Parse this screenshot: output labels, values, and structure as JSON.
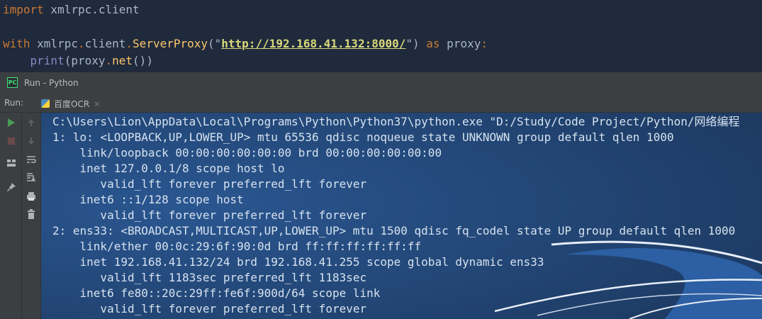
{
  "editor": {
    "line1": {
      "kw": "import",
      "module": " xmlrpc.client"
    },
    "line2": {
      "kw_with": "with",
      "mod": " xmlrpc",
      "dot1": ".",
      "client": "client",
      "dot2": ".",
      "fn": "ServerProxy",
      "open": "(\"",
      "url": "http://192.168.41.132:8000/",
      "close": "\")",
      "kw_as": " as",
      "var": " proxy",
      "colon": ":"
    },
    "line3": {
      "indent": "    ",
      "print": "print",
      "open": "(proxy",
      "dot": ".",
      "method": "net",
      "close": "())"
    }
  },
  "run_window": {
    "title": "Run - Python",
    "run_label": "Run:",
    "tab_label": "百度OCR",
    "tab_close": "×"
  },
  "console": {
    "lines": [
      "C:\\Users\\Lion\\AppData\\Local\\Programs\\Python\\Python37\\python.exe \"D:/Study/Code Project/Python/网络编程",
      "1: lo: <LOOPBACK,UP,LOWER_UP> mtu 65536 qdisc noqueue state UNKNOWN group default qlen 1000",
      "    link/loopback 00:00:00:00:00:00 brd 00:00:00:00:00:00",
      "    inet 127.0.0.1/8 scope host lo",
      "       valid_lft forever preferred_lft forever",
      "    inet6 ::1/128 scope host",
      "       valid_lft forever preferred_lft forever",
      "2: ens33: <BROADCAST,MULTICAST,UP,LOWER_UP> mtu 1500 qdisc fq_codel state UP group default qlen 1000",
      "    link/ether 00:0c:29:6f:90:0d brd ff:ff:ff:ff:ff:ff",
      "    inet 192.168.41.132/24 brd 192.168.41.255 scope global dynamic ens33",
      "       valid_lft 1183sec preferred_lft 1183sec",
      "    inet6 fe80::20c:29ff:fe6f:900d/64 scope link",
      "       valid_lft forever preferred_lft forever"
    ]
  },
  "icons": {
    "left": [
      "run-icon",
      "stop-icon",
      "layout-icon",
      "pin-icon"
    ],
    "right": [
      "up-arrow-icon",
      "down-arrow-icon",
      "soft-wrap-icon",
      "scroll-to-end-icon",
      "print-icon",
      "trash-icon"
    ]
  },
  "colors": {
    "editor_bg": "#1f2a3c",
    "console_bg": "#21426e",
    "keyword": "#cc7832",
    "run_green": "#499c54"
  }
}
